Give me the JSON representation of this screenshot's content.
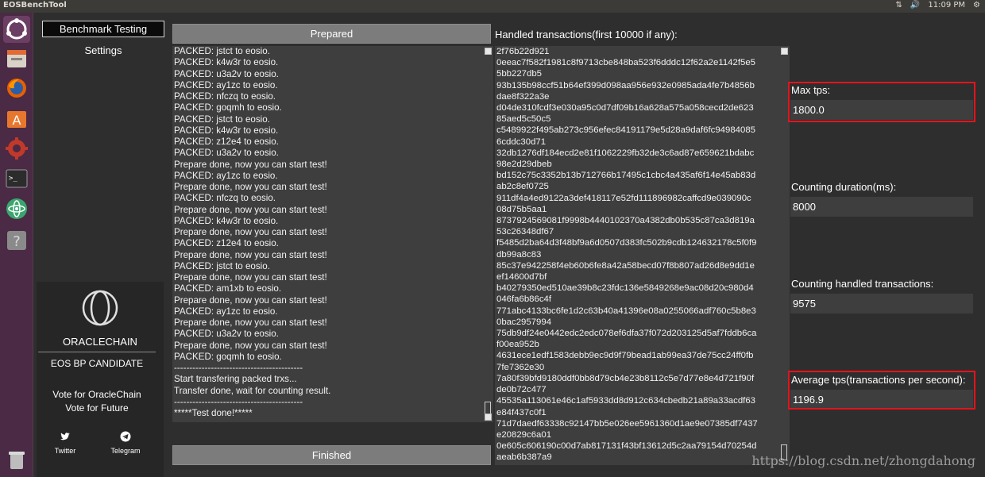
{
  "window": {
    "title": "EOSBenchTool",
    "clock": "11:09 PM"
  },
  "colors": {
    "launcher_bg": "#4a2a44",
    "highlight": "#e4141b",
    "button_gray": "#7c7c7c"
  },
  "launcher": {
    "icons": [
      "ubuntu-dash-icon",
      "file-manager-icon",
      "firefox-icon",
      "software-center-icon",
      "system-settings-icon",
      "terminal-icon",
      "atom-icon",
      "help-icon",
      "trash-icon"
    ]
  },
  "sidebar": {
    "benchmark_label": "Benchmark Testing",
    "settings_label": "Settings"
  },
  "brand": {
    "name": "ORACLECHAIN",
    "candidate": "EOS BP CANDIDATE",
    "vote_line1": "Vote for OracleChain",
    "vote_line2": "Vote for Future",
    "twitter_label": "Twitter",
    "telegram_label": "Telegram"
  },
  "main": {
    "prepared_label": "Prepared",
    "finished_label": "Finished",
    "handled_label": "Handled transactions(first 10000 if any):",
    "log_lines": [
      "PACKED: jstct to eosio.",
      "PACKED: k4w3r to eosio.",
      "PACKED: u3a2v to eosio.",
      "PACKED: ay1zc to eosio.",
      "PACKED: nfczq to eosio.",
      "PACKED: goqmh to eosio.",
      "PACKED: jstct to eosio.",
      "PACKED: k4w3r to eosio.",
      "PACKED: z12e4 to eosio.",
      "PACKED: u3a2v to eosio.",
      "Prepare done, now you can start test!",
      "PACKED: ay1zc to eosio.",
      "Prepare done, now you can start test!",
      "PACKED: nfczq to eosio.",
      "Prepare done, now you can start test!",
      "PACKED: k4w3r to eosio.",
      "Prepare done, now you can start test!",
      "PACKED: z12e4 to eosio.",
      "Prepare done, now you can start test!",
      "PACKED: jstct to eosio.",
      "Prepare done, now you can start test!",
      "PACKED: am1xb to eosio.",
      "Prepare done, now you can start test!",
      "PACKED: ay1zc to eosio.",
      "Prepare done, now you can start test!",
      "PACKED: u3a2v to eosio.",
      "Prepare done, now you can start test!",
      "PACKED: goqmh to eosio.",
      "------------------------------------------",
      "Start transfering packed trxs...",
      "Transfer done, wait for counting result.",
      "------------------------------------------",
      "*****Test done!*****"
    ],
    "trx_lines": [
      "2f76b22d921",
      "0eeac7f582f1981c8f9713cbe848ba523f6dddc12f62a2e1142f5e5",
      "5bb227db5",
      "93b135b98ccf51b64ef399d098aa956e932e0985ada4fe7b4856b",
      "dae8f322a3e",
      "d04de310fcdf3e030a95c0d7df09b16a628a575a058cecd2de623",
      "85aed5c50c5",
      "c5489922f495ab273c956efec84191179e5d28a9daf6fc94984085",
      "6cddc30d71",
      "32db1276df184ecd2e81f1062229fb32de3c6ad87e659621bdabc",
      "98e2d29dbeb",
      "bd152c75c3352b13b712766b17495c1cbc4a435af6f14e45ab83d",
      "ab2c8ef0725",
      "911df4a4ed9122a3def418117e52fd111896982caffcd9e039090c",
      "08d75b5aa1",
      "8737924569081f9998b4440102370a4382db0b535c87ca3d819a",
      "53c26348df67",
      "f5485d2ba64d3f48bf9a6d0507d383fc502b9cdb124632178c5f0f9",
      "db99a8c83",
      "85c37e942258f4eb60b6fe8a42a58becd07f8b807ad26d8e9dd1e",
      "ef14600d7bf",
      "b40279350ed510ae39b8c23fdc136e5849268e9ac08d20c980d4",
      "046fa6b86c4f",
      "771abc4133bc6fe1d2c63b40a41396e08a0255066adf760c5b8e3",
      "0bac2957994",
      "75db9df24e0442edc2edc078ef6dfa37f072d203125d5af7fddb6ca",
      "f00ea952b",
      "4631ece1edf1583debb9ec9d9f79bead1ab99ea37de75cc24ff0fb",
      "7fe7362e30",
      "7a80f39bfd9180ddf0bb8d79cb4e23b8112c5e7d77e8e4d721f90f",
      "de0b72c477",
      "45535a113061e46c1af5933dd8d912c634cbedb21a89a33acdf63",
      "e84f437c0f1",
      "71d7daedf63338c92147bb5e026ee5961360d1ae9e07385df7437",
      "e20829c6a01",
      "0e605c606190c00d7ab817131f43bf13612d5c2aa79154d70254d",
      "aeab6b387a9"
    ]
  },
  "stats": {
    "max_tps_label": "Max tps:",
    "max_tps_value": "1800.0",
    "duration_label": "Counting duration(ms):",
    "duration_value": "8000",
    "handled_count_label": "Counting handled transactions:",
    "handled_count_value": "9575",
    "avg_tps_label": "Average tps(transactions per second):",
    "avg_tps_value": "1196.9"
  },
  "watermark": "https://blog.csdn.net/zhongdahong"
}
